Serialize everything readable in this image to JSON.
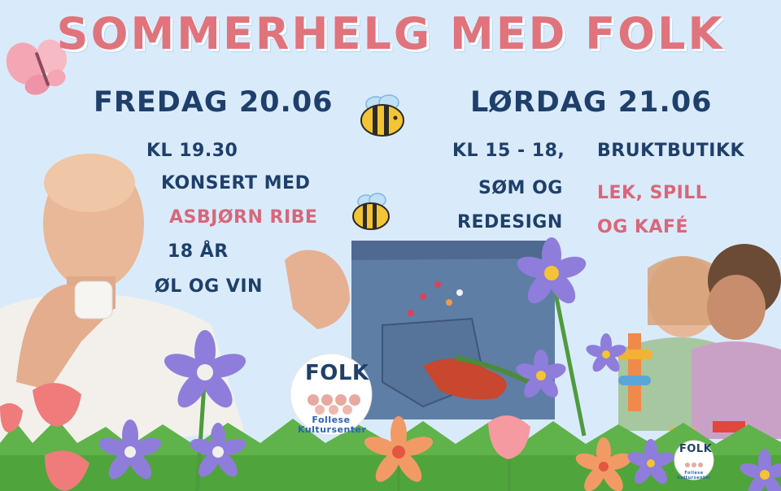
{
  "poster": {
    "title": "SOMMERHELG MED FOLK",
    "friday": {
      "heading": "FREDAG 20.06",
      "time": "KL 19.30",
      "concert": "KONSERT MED",
      "artist": "ASBJØRN RIBE",
      "age": "18 ÅR",
      "drinks": "ØL OG VIN"
    },
    "saturday": {
      "heading": "LØRDAG 21.06",
      "time": "KL 15 - 18,",
      "sewing": "SØM OG",
      "redesign": "REDESIGN",
      "shop": "BRUKTBUTIKK",
      "play": "LEK, SPILL",
      "cafe": "OG KAFÉ"
    },
    "logo": {
      "mark": "FOLK",
      "name_line1": "Follese",
      "name_line2": "Kultursenter"
    }
  },
  "colors": {
    "background": "#d9ebfa",
    "title": "#e0737c",
    "text": "#1f3f6b",
    "accent_pink": "#d9667a",
    "grass": "#5fb34a"
  },
  "icons": [
    "butterfly-icon",
    "bee-icon",
    "flower-icon",
    "folk-logo-icon"
  ]
}
